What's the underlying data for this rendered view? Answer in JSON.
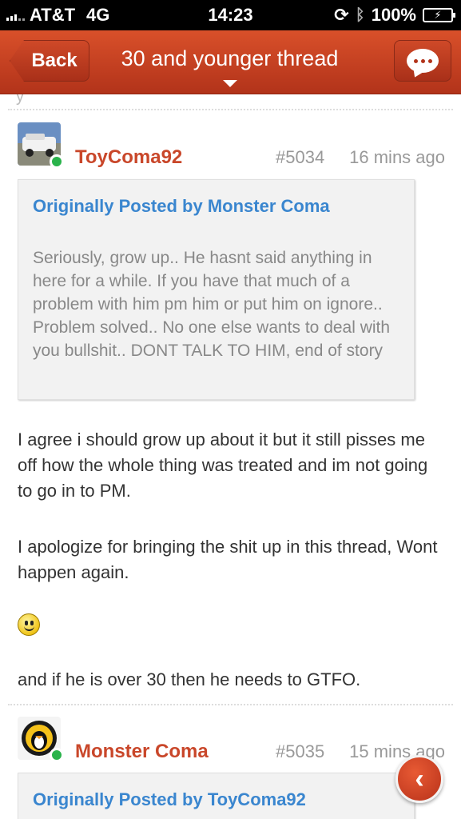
{
  "status_bar": {
    "carrier": "AT&T",
    "network": "4G",
    "time": "14:23",
    "battery": "100%",
    "icons": [
      "signal-icon",
      "rotation-lock-icon",
      "bluetooth-icon",
      "battery-icon"
    ]
  },
  "nav": {
    "back_label": "Back",
    "title": "30 and younger thread",
    "chat_icon": "chat-bubble-icon"
  },
  "posts": [
    {
      "username": "ToyComa92",
      "post_number": "#5034",
      "time": "16 mins ago",
      "online": true,
      "quote": {
        "header": "Originally Posted by Monster Coma",
        "text": "Seriously, grow up.. He hasnt said anything in here for a while.  If you have that much of a problem with him pm him or put him on ignore.. Problem solved.. No one else wants to deal with you bullshit.. DONT TALK TO HIM, end of story"
      },
      "paragraphs": [
        "I agree i should grow up about it but it still pisses me off how the whole thing was treated and im not going to go in to PM.",
        "I apologize for bringing the shit up in this thread, Wont happen again.",
        "and if he is over 30 then he needs to GTFO."
      ]
    },
    {
      "username": "Monster Coma",
      "post_number": "#5035",
      "time": "15 mins ago",
      "online": true,
      "quote": {
        "header": "Originally Posted by ToyComa92"
      }
    }
  ],
  "colors": {
    "nav_red": "#c4401f",
    "username_red": "#c9472a",
    "quote_blue": "#3a86cf",
    "online_green": "#2ab34b"
  }
}
